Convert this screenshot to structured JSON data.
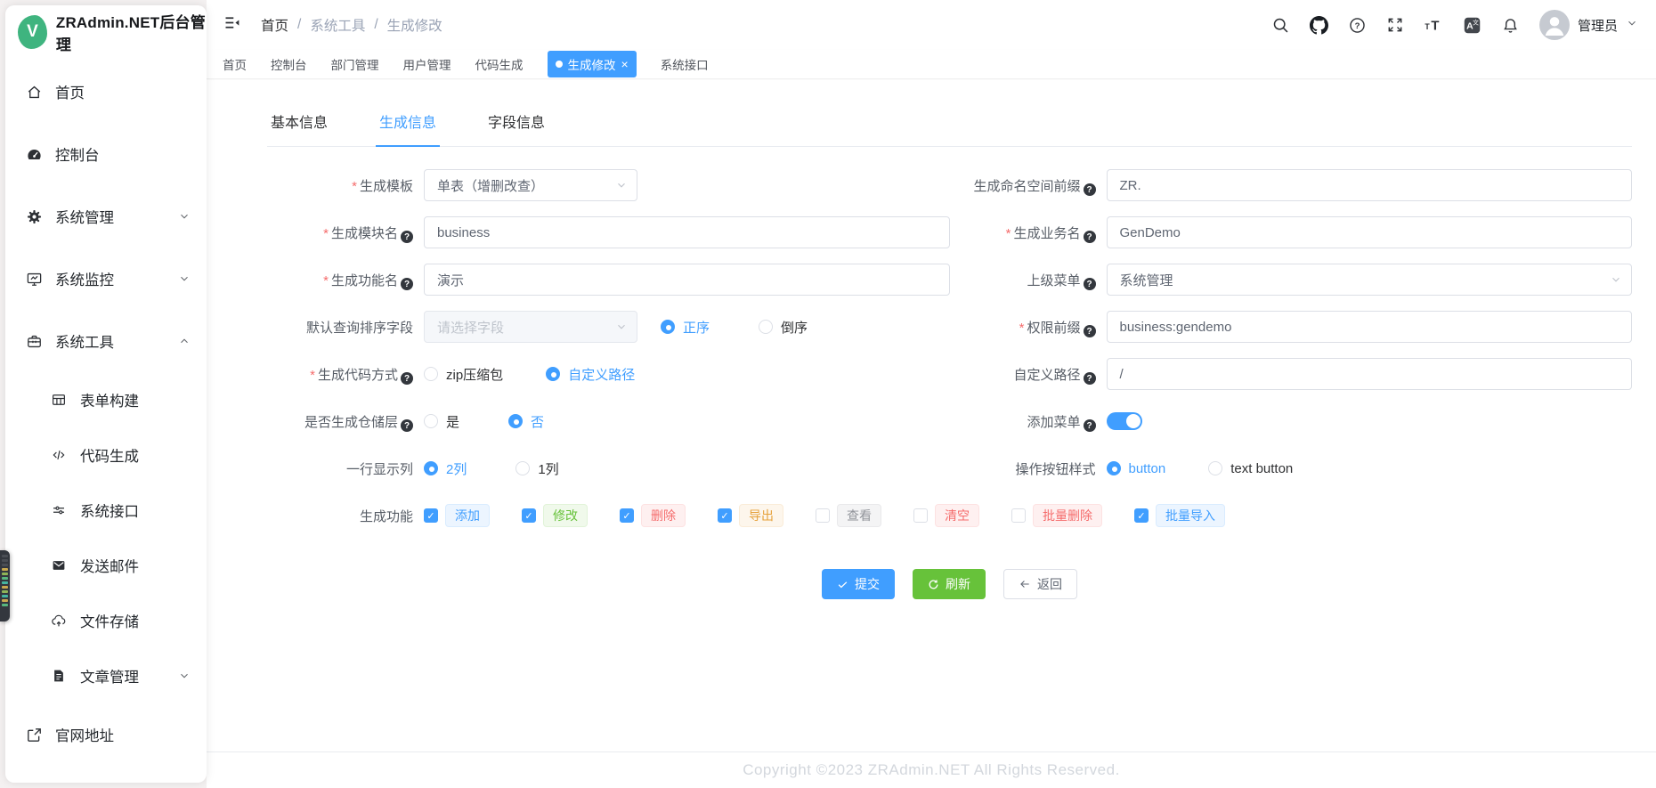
{
  "app": {
    "title": "ZRAdmin.NET后台管理",
    "logo_letter": "V"
  },
  "sidebar": {
    "items": [
      {
        "label": "首页"
      },
      {
        "label": "控制台"
      },
      {
        "label": "系统管理"
      },
      {
        "label": "系统监控"
      },
      {
        "label": "系统工具"
      },
      {
        "label": "表单构建"
      },
      {
        "label": "代码生成"
      },
      {
        "label": "系统接口"
      },
      {
        "label": "发送邮件"
      },
      {
        "label": "文件存储"
      },
      {
        "label": "文章管理"
      },
      {
        "label": "官网地址"
      }
    ]
  },
  "header": {
    "breadcrumb": {
      "items": [
        "首页",
        "系统工具",
        "生成修改"
      ],
      "separator": "/"
    },
    "user": {
      "name": "管理员"
    }
  },
  "tabbar": {
    "tabs": [
      {
        "label": "首页"
      },
      {
        "label": "控制台"
      },
      {
        "label": "部门管理"
      },
      {
        "label": "用户管理"
      },
      {
        "label": "代码生成"
      },
      {
        "label": "生成修改",
        "active": true,
        "close_glyph": "×"
      },
      {
        "label": "系统接口"
      }
    ]
  },
  "content": {
    "tabs": [
      {
        "label": "基本信息"
      },
      {
        "label": "生成信息",
        "active": true
      },
      {
        "label": "字段信息"
      }
    ],
    "form": {
      "template": {
        "label": "生成模板",
        "value": "单表（增删改查）",
        "required": true
      },
      "namespace": {
        "label": "生成命名空间前缀",
        "value": "ZR."
      },
      "module": {
        "label": "生成模块名",
        "value": "business",
        "required": true
      },
      "business": {
        "label": "生成业务名",
        "value": "GenDemo",
        "required": true
      },
      "func": {
        "label": "生成功能名",
        "value": "演示",
        "required": true
      },
      "parent_menu": {
        "label": "上级菜单",
        "value": "系统管理"
      },
      "sort": {
        "label": "默认查询排序字段",
        "placeholder": "请选择字段",
        "asc": "正序",
        "desc": "倒序",
        "selected": "正序"
      },
      "perm": {
        "label": "权限前缀",
        "value": "business:gendemo",
        "required": true
      },
      "code_mode": {
        "label": "生成代码方式",
        "zip": "zip压缩包",
        "custom": "自定义路径",
        "selected": "自定义路径",
        "required": true
      },
      "path": {
        "label": "自定义路径",
        "value": "/"
      },
      "repo": {
        "label": "是否生成仓储层",
        "yes": "是",
        "no": "否",
        "selected": "否"
      },
      "menu_toggle": {
        "label": "添加菜单",
        "state": "on"
      },
      "cols": {
        "label": "一行显示列",
        "two": "2列",
        "one": "1列",
        "selected": "2列"
      },
      "btn_style": {
        "label": "操作按钮样式",
        "a": "button",
        "b": "text button",
        "selected": "button"
      },
      "features": {
        "label": "生成功能",
        "items": [
          {
            "label": "添加",
            "checked": true,
            "color": "blue"
          },
          {
            "label": "修改",
            "checked": true,
            "color": "green"
          },
          {
            "label": "删除",
            "checked": true,
            "color": "red"
          },
          {
            "label": "导出",
            "checked": true,
            "color": "orange"
          },
          {
            "label": "查看",
            "checked": false,
            "color": "gray"
          },
          {
            "label": "清空",
            "checked": false,
            "color": "red"
          },
          {
            "label": "批量删除",
            "checked": false,
            "color": "red"
          },
          {
            "label": "批量导入",
            "checked": true,
            "color": "blue"
          }
        ]
      }
    },
    "actions": {
      "submit": "提交",
      "refresh": "刷新",
      "back": "返回"
    }
  },
  "footer": {
    "copyright": "Copyright ©2023 ZRAdmin.NET All Rights Reserved."
  },
  "colors": {
    "primary": "#409eff",
    "success": "#67c23a",
    "danger": "#f56c6c",
    "warning": "#e6a23c",
    "info": "#909399",
    "logo": "#3fb47f"
  }
}
